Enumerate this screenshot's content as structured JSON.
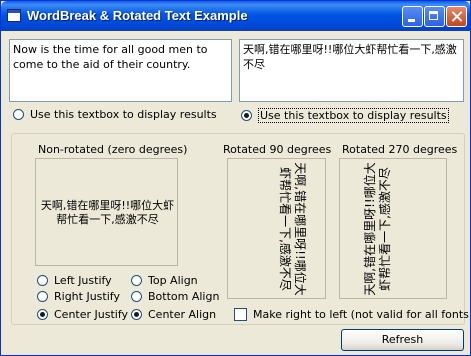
{
  "window": {
    "title": "WordBreak & Rotated Text Example",
    "controls": [
      "minimize",
      "maximize",
      "close"
    ]
  },
  "textboxes": {
    "left": "Now is the time for all good men to come to the aid of their country.",
    "right": "天啊,错在哪里呀!!哪位大虾帮忙看一下,感激不尽"
  },
  "display_target": {
    "left_label": "Use this textbox to display results",
    "right_label": "Use this textbox to display results",
    "selected": "right"
  },
  "previews": {
    "nonrotated_title": "Non-rotated (zero degrees)",
    "rot90_title": "Rotated 90 degrees",
    "rot270_title": "Rotated 270 degrees",
    "text": "天啊,错在哪里呀!!哪位大虾帮忙看一下,感激不尽"
  },
  "justify": {
    "left": "Left Justify",
    "right": "Right Justify",
    "center": "Center Justify",
    "selected": "center"
  },
  "align": {
    "top": "Top Align",
    "bottom": "Bottom Align",
    "center": "Center Align",
    "selected": "center"
  },
  "rtl_checkbox": {
    "label": "Make right to left (not valid for all fonts)",
    "checked": false
  },
  "refresh_button": "Refresh",
  "colors": {
    "titlebar": "#0055e5",
    "window_bg": "#ece9d8",
    "textbox_border": "#7f9db9"
  }
}
